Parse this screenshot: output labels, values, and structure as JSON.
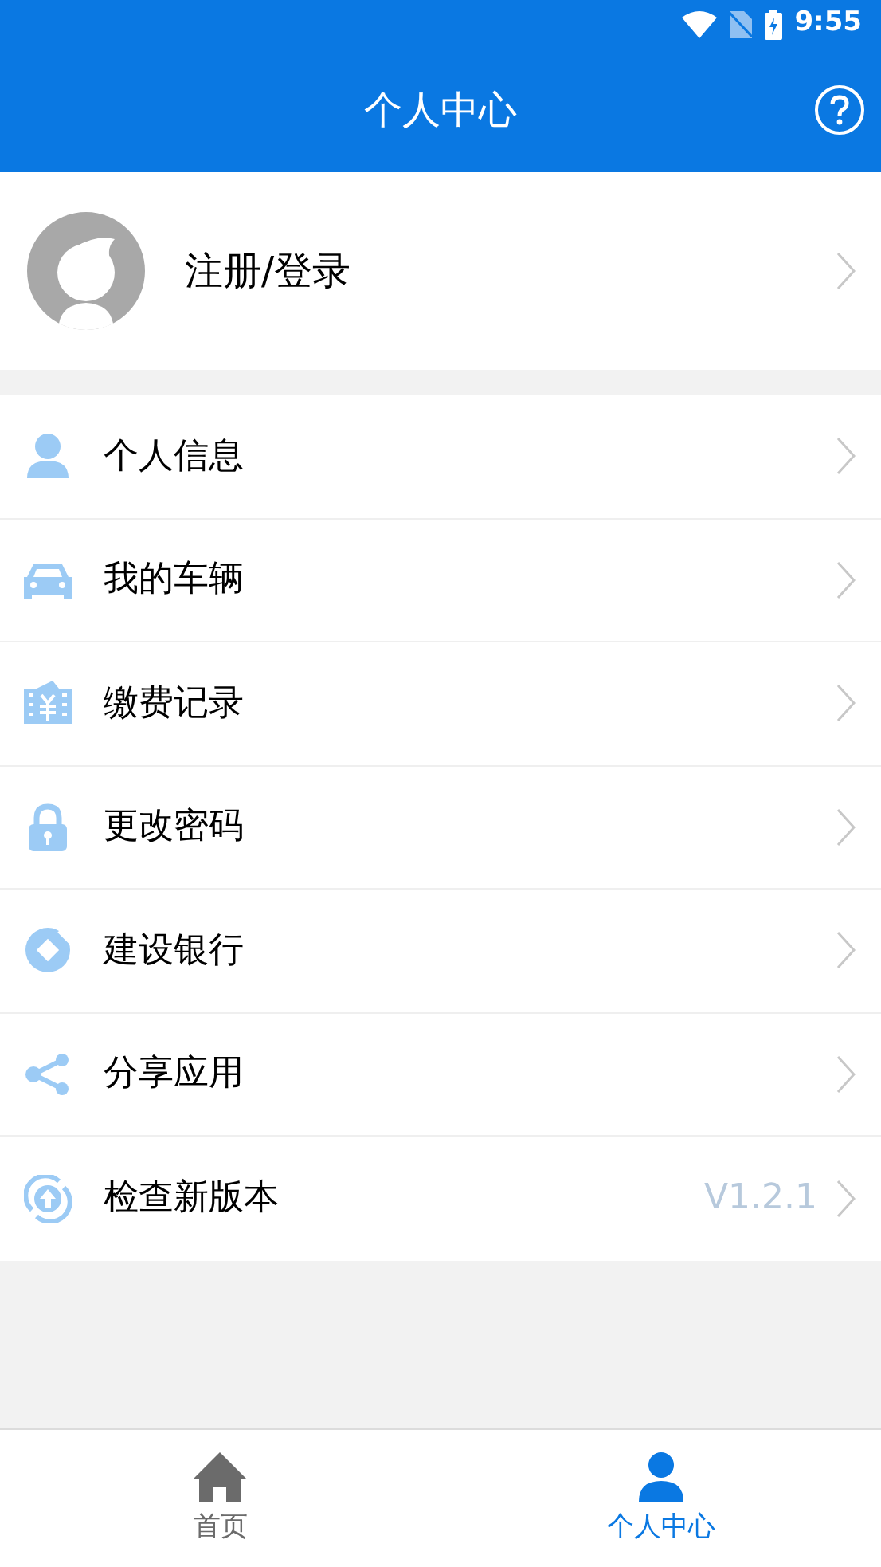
{
  "status_bar": {
    "time": "9:55"
  },
  "header": {
    "title": "个人中心"
  },
  "profile": {
    "label": "注册/登录"
  },
  "menu": [
    {
      "kind": "person",
      "label": "个人信息"
    },
    {
      "kind": "car",
      "label": "我的车辆"
    },
    {
      "kind": "bill",
      "label": "缴费记录"
    },
    {
      "kind": "lock",
      "label": "更改密码"
    },
    {
      "kind": "bank",
      "label": "建设银行"
    },
    {
      "kind": "share",
      "label": "分享应用"
    },
    {
      "kind": "update",
      "label": "检查新版本",
      "value": "V1.2.1"
    }
  ],
  "tabs": [
    {
      "kind": "home",
      "label": "首页",
      "selected": false
    },
    {
      "kind": "person",
      "label": "个人中心",
      "selected": true
    }
  ]
}
